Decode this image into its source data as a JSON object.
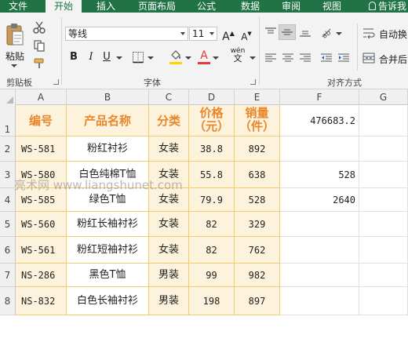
{
  "menu": {
    "tabs": [
      "文件",
      "开始",
      "插入",
      "页面布局",
      "公式",
      "数据",
      "审阅",
      "视图"
    ],
    "active": "开始",
    "tell_me": "告诉我"
  },
  "ribbon": {
    "clipboard": {
      "paste_label": "粘贴",
      "group_label": "剪贴板"
    },
    "font": {
      "name": "等线",
      "size": "11",
      "grow": "A",
      "shrink": "A",
      "bold": "B",
      "italic": "I",
      "underline": "U",
      "font_color_letter": "A",
      "phonetic": "wén",
      "group_label": "字体",
      "fill_color": "#ffd200",
      "font_color": "#e23b3b"
    },
    "alignment": {
      "wrap_label": "自动换",
      "merge_label": "合并后",
      "group_label": "对齐方式"
    }
  },
  "columns": [
    "A",
    "B",
    "C",
    "D",
    "E",
    "F",
    "G"
  ],
  "rows": [
    "1",
    "2",
    "3",
    "4",
    "5",
    "6",
    "7",
    "8"
  ],
  "table": {
    "headers": [
      "编号",
      "产品名称",
      "分类",
      "价格\n（元）",
      "销量\n（件）"
    ],
    "data": [
      [
        "WS-581",
        "粉红衬衫",
        "女装",
        "38.8",
        "892"
      ],
      [
        "WS-580",
        "白色纯棉T恤",
        "女装",
        "55.8",
        "638"
      ],
      [
        "WS-585",
        "绿色T恤",
        "女装",
        "79.9",
        "528"
      ],
      [
        "WS-560",
        "粉红长袖衬衫",
        "女装",
        "82",
        "329"
      ],
      [
        "WS-561",
        "粉红短袖衬衫",
        "女装",
        "82",
        "762"
      ],
      [
        "NS-286",
        "黑色T恤",
        "男装",
        "99",
        "982"
      ],
      [
        "NS-832",
        "白色长袖衬衫",
        "男装",
        "198",
        "897"
      ]
    ]
  },
  "col_f": [
    "476683.2",
    "",
    "528",
    "2640",
    "",
    "",
    "",
    ""
  ],
  "watermark": "亮术网 www.liangshunet.com",
  "colors": {
    "accent": "#217346",
    "header_text": "#e8862b",
    "table_fill": "#fdf3dd",
    "table_border": "#f0cc6e"
  }
}
